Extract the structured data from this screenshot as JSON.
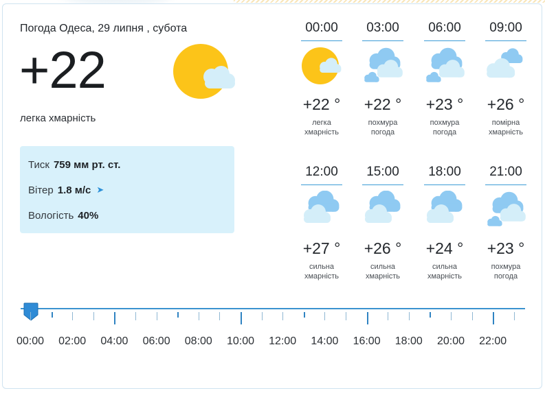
{
  "header": {
    "title": "Погода Одеса, 29 липня , субота",
    "temperature": "+22",
    "condition": "легка хмарність",
    "icon": "sun-cloud-icon"
  },
  "details": {
    "pressure_label": "Тиск",
    "pressure_value": "759 мм рт. ст.",
    "wind_label": "Вітер",
    "wind_value": "1.8 м/с",
    "humidity_label": "Вологість",
    "humidity_value": "40%"
  },
  "hourly": [
    {
      "time": "00:00",
      "temp": "+22 °",
      "desc1": "легка",
      "desc2": "хмарність",
      "icon": "sun-cloud-icon"
    },
    {
      "time": "03:00",
      "temp": "+22 °",
      "desc1": "похмура",
      "desc2": "погода",
      "icon": "overcast-icon"
    },
    {
      "time": "06:00",
      "temp": "+23 °",
      "desc1": "похмура",
      "desc2": "погода",
      "icon": "overcast-icon"
    },
    {
      "time": "09:00",
      "temp": "+26 °",
      "desc1": "помірна",
      "desc2": "хмарність",
      "icon": "partly-cloudy-icon"
    },
    {
      "time": "12:00",
      "temp": "+27 °",
      "desc1": "сильна",
      "desc2": "хмарність",
      "icon": "cloudy-icon"
    },
    {
      "time": "15:00",
      "temp": "+26 °",
      "desc1": "сильна",
      "desc2": "хмарність",
      "icon": "cloudy-icon"
    },
    {
      "time": "18:00",
      "temp": "+24 °",
      "desc1": "сильна",
      "desc2": "хмарність",
      "icon": "cloudy-icon"
    },
    {
      "time": "21:00",
      "temp": "+23 °",
      "desc1": "похмура",
      "desc2": "погода",
      "icon": "overcast-icon"
    }
  ],
  "timeline": {
    "labels": [
      "00:00",
      "02:00",
      "04:00",
      "06:00",
      "08:00",
      "10:00",
      "12:00",
      "14:00",
      "16:00",
      "18:00",
      "20:00",
      "22:00"
    ],
    "selected": "00:00"
  },
  "colors": {
    "sun": "#fcc419",
    "cloud_front": "#d4eef9",
    "cloud_back": "#8fcaf2",
    "accent": "#3a92cf",
    "info_bg": "#d8f1fb"
  }
}
